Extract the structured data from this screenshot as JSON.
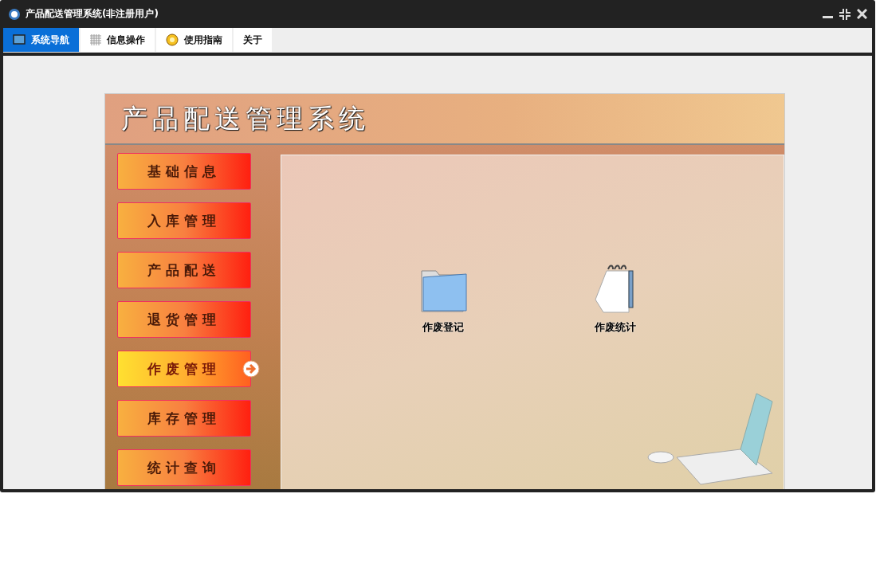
{
  "window": {
    "title": "产品配送管理系统(非注册用户)"
  },
  "tabs": [
    {
      "label": "系统导航",
      "kind": "monitor",
      "selected": true
    },
    {
      "label": "信息操作",
      "kind": "grid",
      "selected": false
    },
    {
      "label": "使用指南",
      "kind": "help",
      "selected": false
    },
    {
      "label": "关于",
      "kind": "text",
      "selected": false
    }
  ],
  "banner": {
    "title": "产品配送管理系统"
  },
  "menu": [
    {
      "label": "基础信息",
      "selected": false
    },
    {
      "label": "入库管理",
      "selected": false
    },
    {
      "label": "产品配送",
      "selected": false
    },
    {
      "label": "退货管理",
      "selected": false
    },
    {
      "label": "作废管理",
      "selected": true
    },
    {
      "label": "库存管理",
      "selected": false
    },
    {
      "label": "统计查询",
      "selected": false
    }
  ],
  "actions": [
    {
      "label": "作废登记",
      "kind": "folder"
    },
    {
      "label": "作废统计",
      "kind": "notepad"
    }
  ]
}
